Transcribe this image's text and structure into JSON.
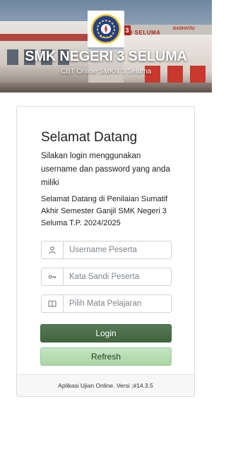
{
  "header": {
    "school_name": "SMK NEGERI 3 SELUMA",
    "subtitle": "CBT Online SMKN 3 Seluma",
    "banner_sign": "3 SELUMA",
    "banner_sign_number": "3",
    "banner_sign_right": "DASHATIU",
    "logo_icon": "school-emblem-icon"
  },
  "card": {
    "welcome_title": "Selamat Datang",
    "instruction": "Silakan login menggunakan username dan password yang anda miliki",
    "description": "Selamat Datang di Penilaian Sumatif Akhir Semester Ganjil SMK Negeri 3 Seluma T.P. 2024/2025",
    "username": {
      "value": "",
      "placeholder": "Username Peserta",
      "icon": "user-icon"
    },
    "password": {
      "value": "",
      "placeholder": "Kata Sandi Peserta",
      "icon": "key-icon"
    },
    "subject": {
      "value": "",
      "placeholder": "Pilih Mata Pelajaran",
      "icon": "book-icon"
    },
    "login_label": "Login",
    "refresh_label": "Refresh",
    "footer": "Aplikasi Ujian Online. Versi ;#14.3.5"
  },
  "colors": {
    "login_button": "#486b48",
    "refresh_button": "#b6dcb6",
    "emblem_blue": "#1f3f94",
    "emblem_yellow": "#f2c21b",
    "brand_red": "#b0261f"
  }
}
